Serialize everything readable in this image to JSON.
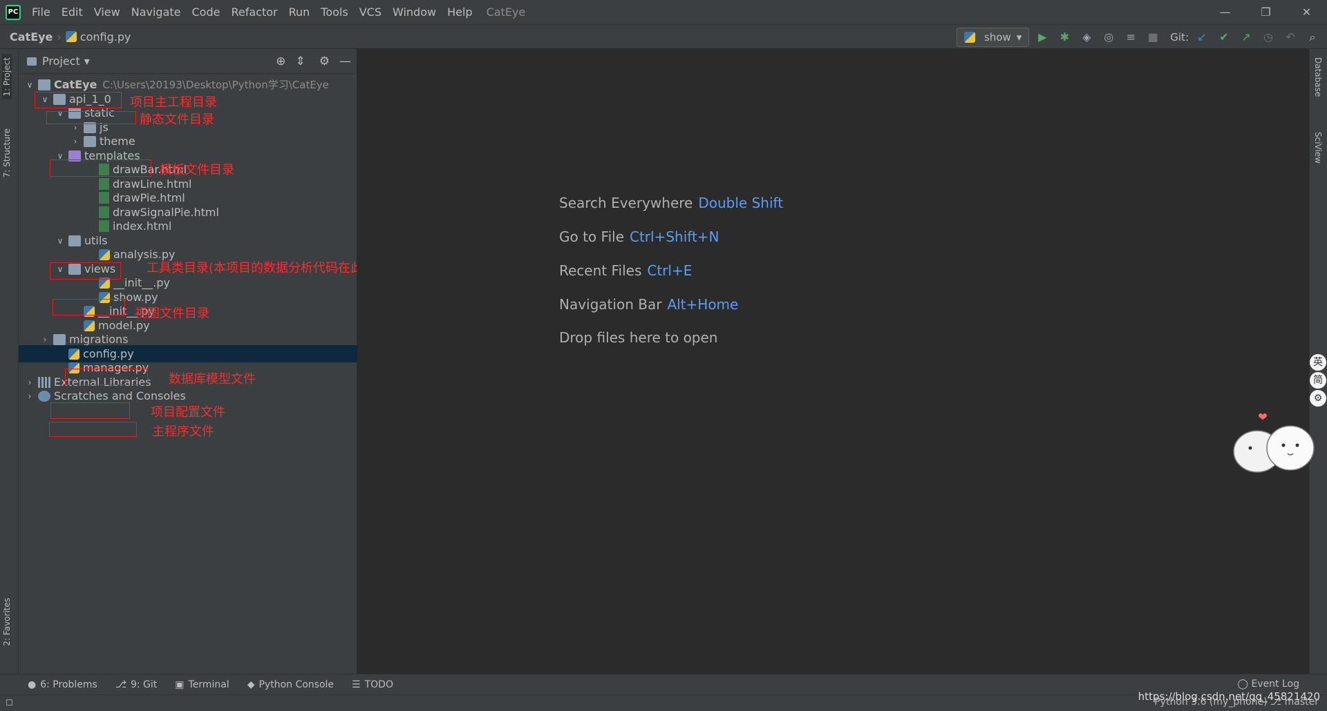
{
  "window": {
    "title": "CatEye",
    "menu": [
      "File",
      "Edit",
      "View",
      "Navigate",
      "Code",
      "Refactor",
      "Run",
      "Tools",
      "VCS",
      "Window",
      "Help"
    ],
    "controls": [
      "—",
      "❐",
      "✕"
    ]
  },
  "breadcrumb": {
    "project": "CatEye",
    "file": "config.py"
  },
  "toolbar": {
    "run_config": "show",
    "git_label": "Git:"
  },
  "left_stripe": {
    "project_tab": "1: Project",
    "structure_tab": "7: Structure",
    "favorites_tab": "2: Favorites"
  },
  "right_stripe": {
    "database_tab": "Database",
    "sciview_tab": "SciView"
  },
  "project_panel": {
    "title": "Project",
    "tree": [
      {
        "label": "CatEye",
        "path": "C:\\Users\\20193\\Desktop\\Python学习\\CatEye",
        "indent": 0,
        "arrow": "v",
        "icon": "folder"
      },
      {
        "label": "api_1_0",
        "indent": 1,
        "arrow": "v",
        "icon": "module"
      },
      {
        "label": "static",
        "indent": 2,
        "arrow": "v",
        "icon": "folder"
      },
      {
        "label": "js",
        "indent": 3,
        "arrow": ">",
        "icon": "folder"
      },
      {
        "label": "theme",
        "indent": 3,
        "arrow": ">",
        "icon": "folder"
      },
      {
        "label": "templates",
        "indent": 2,
        "arrow": "v",
        "icon": "purple"
      },
      {
        "label": "drawBar.html",
        "indent": 4,
        "arrow": "",
        "icon": "html"
      },
      {
        "label": "drawLine.html",
        "indent": 4,
        "arrow": "",
        "icon": "html"
      },
      {
        "label": "drawPie.html",
        "indent": 4,
        "arrow": "",
        "icon": "html"
      },
      {
        "label": "drawSignalPie.html",
        "indent": 4,
        "arrow": "",
        "icon": "html"
      },
      {
        "label": "index.html",
        "indent": 4,
        "arrow": "",
        "icon": "html"
      },
      {
        "label": "utils",
        "indent": 2,
        "arrow": "v",
        "icon": "folder"
      },
      {
        "label": "analysis.py",
        "indent": 4,
        "arrow": "",
        "icon": "py"
      },
      {
        "label": "views",
        "indent": 2,
        "arrow": "v",
        "icon": "module"
      },
      {
        "label": "__init__.py",
        "indent": 4,
        "arrow": "",
        "icon": "py"
      },
      {
        "label": "show.py",
        "indent": 4,
        "arrow": "",
        "icon": "py"
      },
      {
        "label": "__init__.py",
        "indent": 3,
        "arrow": "",
        "icon": "py"
      },
      {
        "label": "model.py",
        "indent": 3,
        "arrow": "",
        "icon": "py"
      },
      {
        "label": "migrations",
        "indent": 1,
        "arrow": ">",
        "icon": "folder"
      },
      {
        "label": "config.py",
        "indent": 2,
        "arrow": "",
        "icon": "py",
        "selected": true
      },
      {
        "label": "manager.py",
        "indent": 2,
        "arrow": "",
        "icon": "py"
      },
      {
        "label": "External Libraries",
        "indent": 0,
        "arrow": ">",
        "icon": "lib"
      },
      {
        "label": "Scratches and Consoles",
        "indent": 0,
        "arrow": ">",
        "icon": "scratch"
      }
    ]
  },
  "annotations": [
    {
      "text": "项目主工程目录"
    },
    {
      "text": "静态文件目录"
    },
    {
      "text": "模板文件目录"
    },
    {
      "text": "工具类目录(本项目的数据分析代码在此目录下的analysis.py文件下)"
    },
    {
      "text": "视图文件目录"
    },
    {
      "text": "数据库模型文件"
    },
    {
      "text": "项目配置文件"
    },
    {
      "text": "主程序文件"
    }
  ],
  "editor_hints": [
    {
      "label": "Search Everywhere",
      "key": "Double Shift"
    },
    {
      "label": "Go to File",
      "key": "Ctrl+Shift+N"
    },
    {
      "label": "Recent Files",
      "key": "Ctrl+E"
    },
    {
      "label": "Navigation Bar",
      "key": "Alt+Home"
    },
    {
      "label": "Drop files here to open",
      "key": ""
    }
  ],
  "ime": [
    "英",
    "简",
    "⚙"
  ],
  "bottom_tabs": [
    "6: Problems",
    "9: Git",
    "Terminal",
    "Python Console",
    "TODO"
  ],
  "event_log": "Event Log",
  "status": "Python 3.6 (my_phone)   ⎇ master",
  "watermark": "https://blog.csdn.net/qq_45821420",
  "colors": {
    "accent_blue": "#589df6",
    "annotation_red": "#ff2a2a",
    "selection": "#0d293e"
  }
}
